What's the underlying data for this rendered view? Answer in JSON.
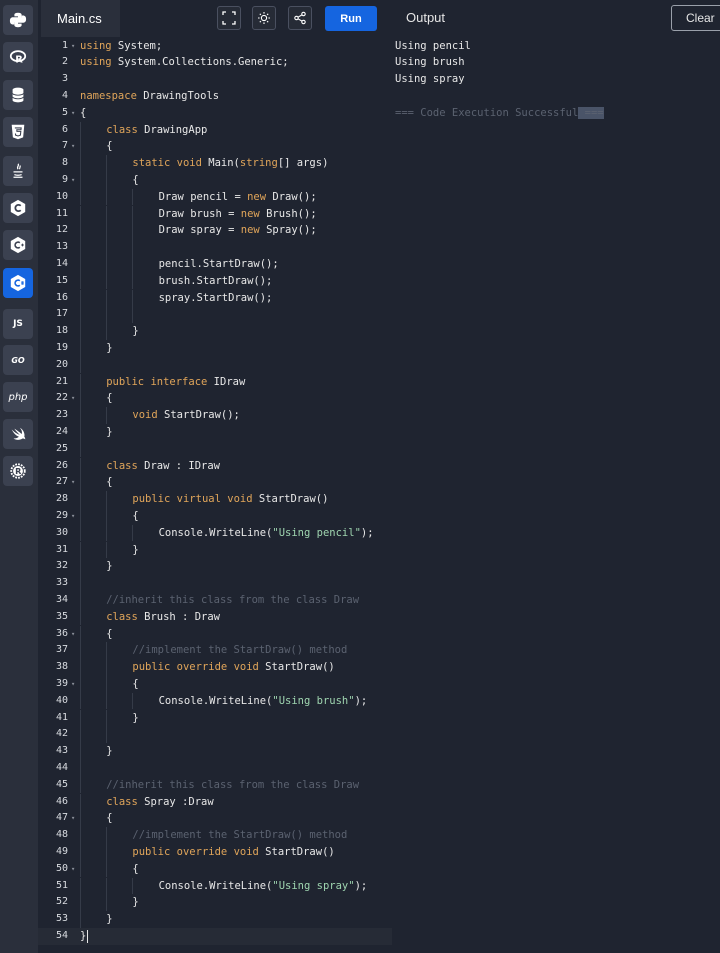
{
  "colors": {
    "accent": "#1565e0",
    "keyword": "#e0a55a",
    "string": "#9fd5b0",
    "comment": "#5b6270",
    "text": "#e8e8e8",
    "background": "#1f2430",
    "rail": "#2a2f3b"
  },
  "sidebar": {
    "items": [
      {
        "name": "python-icon",
        "label": ""
      },
      {
        "name": "r-icon",
        "label": ""
      },
      {
        "name": "sql-database-icon",
        "label": ""
      },
      {
        "name": "html5-icon",
        "label": ""
      },
      {
        "name": "java-icon",
        "label": ""
      },
      {
        "name": "c-icon",
        "label": ""
      },
      {
        "name": "cpp-icon",
        "label": ""
      },
      {
        "name": "csharp-icon",
        "label": "",
        "active": true
      },
      {
        "name": "javascript-icon",
        "label": "JS"
      },
      {
        "name": "go-icon",
        "label": "GO"
      },
      {
        "name": "php-icon",
        "label": "php"
      },
      {
        "name": "swift-icon",
        "label": ""
      },
      {
        "name": "rust-icon",
        "label": ""
      }
    ]
  },
  "header": {
    "file_tab": "Main.cs",
    "run_label": "Run",
    "output_title": "Output",
    "clear_label": "Clear",
    "tools": [
      "fullscreen-icon",
      "theme-sun-icon",
      "share-icon"
    ]
  },
  "editor": {
    "lines": [
      {
        "n": "1",
        "fold": true,
        "indent": 0,
        "tokens": [
          [
            "kw",
            "using"
          ],
          [
            "ty",
            " System;"
          ]
        ]
      },
      {
        "n": "2",
        "indent": 0,
        "tokens": [
          [
            "kw",
            "using"
          ],
          [
            "ty",
            " System.Collections.Generic;"
          ]
        ]
      },
      {
        "n": "3",
        "indent": 0,
        "tokens": []
      },
      {
        "n": "4",
        "indent": 0,
        "tokens": [
          [
            "kw",
            "namespace"
          ],
          [
            "ty",
            " DrawingTools"
          ]
        ]
      },
      {
        "n": "5",
        "fold": true,
        "indent": 0,
        "tokens": [
          [
            "ty",
            "{"
          ]
        ]
      },
      {
        "n": "6",
        "indent": 1,
        "tokens": [
          [
            "kw",
            "class"
          ],
          [
            "ty",
            " DrawingApp"
          ]
        ]
      },
      {
        "n": "7",
        "fold": true,
        "indent": 1,
        "tokens": [
          [
            "ty",
            "{"
          ]
        ]
      },
      {
        "n": "8",
        "indent": 2,
        "tokens": [
          [
            "kw",
            "static"
          ],
          [
            "ty",
            " "
          ],
          [
            "kw",
            "void"
          ],
          [
            "ty",
            " Main("
          ],
          [
            "kw",
            "string"
          ],
          [
            "ty",
            "[] args)"
          ]
        ]
      },
      {
        "n": "9",
        "fold": true,
        "indent": 2,
        "tokens": [
          [
            "ty",
            "{"
          ]
        ]
      },
      {
        "n": "10",
        "indent": 3,
        "tokens": [
          [
            "ty",
            "Draw pencil = "
          ],
          [
            "kw",
            "new"
          ],
          [
            "ty",
            " Draw();"
          ]
        ]
      },
      {
        "n": "11",
        "indent": 3,
        "tokens": [
          [
            "ty",
            "Draw brush = "
          ],
          [
            "kw",
            "new"
          ],
          [
            "ty",
            " Brush();"
          ]
        ]
      },
      {
        "n": "12",
        "indent": 3,
        "tokens": [
          [
            "ty",
            "Draw spray = "
          ],
          [
            "kw",
            "new"
          ],
          [
            "ty",
            " Spray();"
          ]
        ]
      },
      {
        "n": "13",
        "indent": 3,
        "tokens": []
      },
      {
        "n": "14",
        "indent": 3,
        "tokens": [
          [
            "ty",
            "pencil.StartDraw();"
          ]
        ]
      },
      {
        "n": "15",
        "indent": 3,
        "tokens": [
          [
            "ty",
            "brush.StartDraw();"
          ]
        ]
      },
      {
        "n": "16",
        "indent": 3,
        "tokens": [
          [
            "ty",
            "spray.StartDraw();"
          ]
        ]
      },
      {
        "n": "17",
        "indent": 3,
        "tokens": []
      },
      {
        "n": "18",
        "indent": 2,
        "tokens": [
          [
            "ty",
            "}"
          ]
        ]
      },
      {
        "n": "19",
        "indent": 1,
        "tokens": [
          [
            "ty",
            "}"
          ]
        ]
      },
      {
        "n": "20",
        "indent": 1,
        "tokens": []
      },
      {
        "n": "21",
        "indent": 1,
        "tokens": [
          [
            "kw",
            "public"
          ],
          [
            "ty",
            " "
          ],
          [
            "kw",
            "interface"
          ],
          [
            "ty",
            " IDraw"
          ]
        ]
      },
      {
        "n": "22",
        "fold": true,
        "indent": 1,
        "tokens": [
          [
            "ty",
            "{"
          ]
        ]
      },
      {
        "n": "23",
        "indent": 2,
        "tokens": [
          [
            "kw",
            "void"
          ],
          [
            "ty",
            " StartDraw();"
          ]
        ]
      },
      {
        "n": "24",
        "indent": 1,
        "tokens": [
          [
            "ty",
            "}"
          ]
        ]
      },
      {
        "n": "25",
        "indent": 1,
        "tokens": []
      },
      {
        "n": "26",
        "indent": 1,
        "tokens": [
          [
            "kw",
            "class"
          ],
          [
            "ty",
            " Draw : IDraw"
          ]
        ]
      },
      {
        "n": "27",
        "fold": true,
        "indent": 1,
        "tokens": [
          [
            "ty",
            "{"
          ]
        ]
      },
      {
        "n": "28",
        "indent": 2,
        "tokens": [
          [
            "kw",
            "public"
          ],
          [
            "ty",
            " "
          ],
          [
            "kw",
            "virtual"
          ],
          [
            "ty",
            " "
          ],
          [
            "kw",
            "void"
          ],
          [
            "ty",
            " StartDraw()"
          ]
        ]
      },
      {
        "n": "29",
        "fold": true,
        "indent": 2,
        "tokens": [
          [
            "ty",
            "{"
          ]
        ]
      },
      {
        "n": "30",
        "indent": 3,
        "tokens": [
          [
            "ty",
            "Console.WriteLine("
          ],
          [
            "str",
            "\"Using pencil\""
          ],
          [
            "ty",
            ");"
          ]
        ]
      },
      {
        "n": "31",
        "indent": 2,
        "tokens": [
          [
            "ty",
            "}"
          ]
        ]
      },
      {
        "n": "32",
        "indent": 1,
        "tokens": [
          [
            "ty",
            "}"
          ]
        ]
      },
      {
        "n": "33",
        "indent": 1,
        "tokens": []
      },
      {
        "n": "34",
        "indent": 1,
        "tokens": [
          [
            "cm",
            "//inherit this class from the class Draw"
          ]
        ]
      },
      {
        "n": "35",
        "indent": 1,
        "tokens": [
          [
            "kw",
            "class"
          ],
          [
            "ty",
            " Brush : Draw"
          ]
        ]
      },
      {
        "n": "36",
        "fold": true,
        "indent": 1,
        "tokens": [
          [
            "ty",
            "{"
          ]
        ]
      },
      {
        "n": "37",
        "indent": 2,
        "tokens": [
          [
            "cm",
            "//implement the StartDraw() method"
          ]
        ]
      },
      {
        "n": "38",
        "indent": 2,
        "tokens": [
          [
            "kw",
            "public"
          ],
          [
            "ty",
            " "
          ],
          [
            "kw",
            "override"
          ],
          [
            "ty",
            " "
          ],
          [
            "kw",
            "void"
          ],
          [
            "ty",
            " StartDraw()"
          ]
        ]
      },
      {
        "n": "39",
        "fold": true,
        "indent": 2,
        "tokens": [
          [
            "ty",
            "{"
          ]
        ]
      },
      {
        "n": "40",
        "indent": 3,
        "tokens": [
          [
            "ty",
            "Console.WriteLine("
          ],
          [
            "str",
            "\"Using brush\""
          ],
          [
            "ty",
            ");"
          ]
        ]
      },
      {
        "n": "41",
        "indent": 2,
        "tokens": [
          [
            "ty",
            "}"
          ]
        ]
      },
      {
        "n": "42",
        "indent": 2,
        "tokens": []
      },
      {
        "n": "43",
        "indent": 1,
        "tokens": [
          [
            "ty",
            "}"
          ]
        ]
      },
      {
        "n": "44",
        "indent": 1,
        "tokens": []
      },
      {
        "n": "45",
        "indent": 1,
        "tokens": [
          [
            "cm",
            "//inherit this class from the class Draw"
          ]
        ]
      },
      {
        "n": "46",
        "indent": 1,
        "tokens": [
          [
            "kw",
            "class"
          ],
          [
            "ty",
            " Spray :Draw"
          ]
        ]
      },
      {
        "n": "47",
        "fold": true,
        "indent": 1,
        "tokens": [
          [
            "ty",
            "{"
          ]
        ]
      },
      {
        "n": "48",
        "indent": 2,
        "tokens": [
          [
            "cm",
            "//implement the StartDraw() method"
          ]
        ]
      },
      {
        "n": "49",
        "indent": 2,
        "tokens": [
          [
            "kw",
            "public"
          ],
          [
            "ty",
            " "
          ],
          [
            "kw",
            "override"
          ],
          [
            "ty",
            " "
          ],
          [
            "kw",
            "void"
          ],
          [
            "ty",
            " StartDraw()"
          ]
        ]
      },
      {
        "n": "50",
        "fold": true,
        "indent": 2,
        "tokens": [
          [
            "ty",
            "{"
          ]
        ]
      },
      {
        "n": "51",
        "indent": 3,
        "tokens": [
          [
            "ty",
            "Console.WriteLine("
          ],
          [
            "str",
            "\"Using spray\""
          ],
          [
            "ty",
            ");"
          ]
        ]
      },
      {
        "n": "52",
        "indent": 2,
        "tokens": [
          [
            "ty",
            "}"
          ]
        ]
      },
      {
        "n": "53",
        "indent": 1,
        "tokens": [
          [
            "ty",
            "}"
          ]
        ]
      },
      {
        "n": "54",
        "indent": 0,
        "current": true,
        "tokens": [
          [
            "ty",
            "}"
          ]
        ]
      }
    ]
  },
  "output": {
    "lines": [
      "Using pencil",
      "Using brush",
      "Using spray",
      ""
    ],
    "status_text": "=== Code Execution Successful",
    "status_suffix": " ==="
  }
}
